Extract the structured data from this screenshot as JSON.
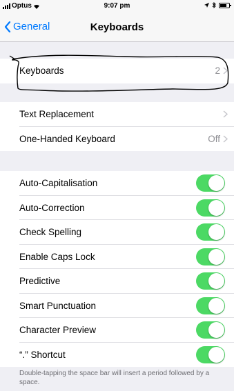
{
  "status_bar": {
    "carrier": "Optus",
    "time": "9:07 pm"
  },
  "nav": {
    "back_label": "General",
    "title": "Keyboards"
  },
  "keyboards_row": {
    "label": "Keyboards",
    "value": "2"
  },
  "group2": [
    {
      "label": "Text Replacement",
      "value": ""
    },
    {
      "label": "One-Handed Keyboard",
      "value": "Off"
    }
  ],
  "toggles": [
    {
      "label": "Auto-Capitalisation",
      "on": true
    },
    {
      "label": "Auto-Correction",
      "on": true
    },
    {
      "label": "Check Spelling",
      "on": true
    },
    {
      "label": "Enable Caps Lock",
      "on": true
    },
    {
      "label": "Predictive",
      "on": true
    },
    {
      "label": "Smart Punctuation",
      "on": true
    },
    {
      "label": "Character Preview",
      "on": true
    },
    {
      "label": "“.” Shortcut",
      "on": true
    }
  ],
  "footer_note": "Double-tapping the space bar will insert a period followed by a space.",
  "colors": {
    "accent": "#007aff",
    "toggle_on": "#4cd964",
    "background": "#efeff4"
  }
}
